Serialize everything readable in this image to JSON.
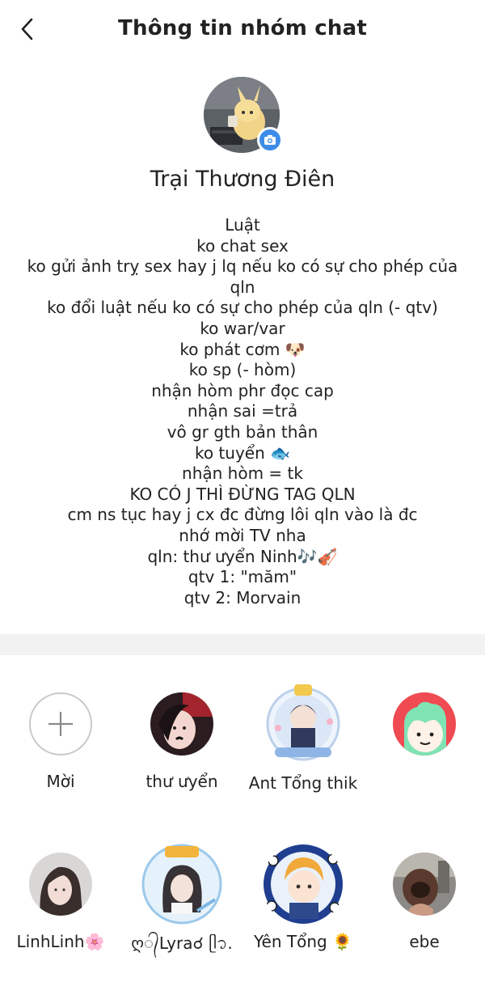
{
  "header": {
    "title": "Thông tin nhóm chat",
    "back_icon": "chevron-left-icon"
  },
  "group": {
    "name": "Trại Thương Điên",
    "camera_icon": "camera-icon"
  },
  "description": {
    "lines": [
      "Luật",
      "ko chat sex",
      "ko gửi ảnh trỵ sex hay j lq nếu ko có sự cho phép của",
      "qln",
      "ko đổi luật nếu ko có sự cho phép của qln (- qtv)",
      "ko war/var",
      "ko phát cơm 🐶",
      "ko sp (- hòm)",
      "nhận hòm phr đọc cap",
      "nhận sai =trả",
      "vô gr gth bản thân",
      "ko tuyển 🐟",
      "nhận hòm = tk",
      "KO CÓ J THÌ ĐỪNG TAG QLN",
      "cm ns tục hay j cx đc đừng lôi qln vào là đc",
      "nhớ mời TV nha",
      "qln: thư ưyển Ninh🎶🎻",
      "qtv 1: \"măm\"",
      "qtv 2:  Morvain"
    ]
  },
  "members": {
    "invite_label": "Mời",
    "invite_icon": "plus-icon",
    "list": [
      {
        "name": "thư ưyển"
      },
      {
        "name": "Ant Tổng thik"
      },
      {
        "name": ""
      },
      {
        "name": "LinhLinh🌸"
      },
      {
        "name": "ღ᭄Lyra☌ ᥫ᭡."
      },
      {
        "name": "Yên Tổng 🌻"
      },
      {
        "name": "ebe"
      }
    ]
  }
}
